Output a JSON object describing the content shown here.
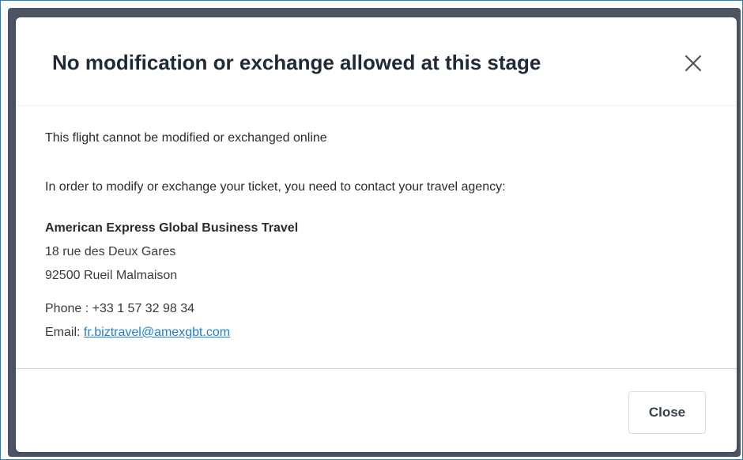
{
  "dialog": {
    "title": "No modification or exchange allowed at this stage",
    "close_icon": "close-x-icon"
  },
  "body": {
    "message": "This flight cannot be modified or exchanged online",
    "instruction": "In order to modify or exchange your ticket, you need to contact your travel agency:",
    "agency": {
      "name": "American Express Global Business Travel",
      "address_line1": "18 rue des Deux Gares",
      "address_line2": "92500 Rueil Malmaison"
    },
    "contact": {
      "phone_label": "Phone : ",
      "phone": "+33 1 57 32 98 34",
      "email_label": "Email: ",
      "email": "fr.biztravel@amexgbt.com"
    }
  },
  "footer": {
    "close_label": "Close"
  },
  "colors": {
    "link": "#1f7fc9",
    "backdrop": "#4b5563",
    "title": "#1f2937"
  }
}
